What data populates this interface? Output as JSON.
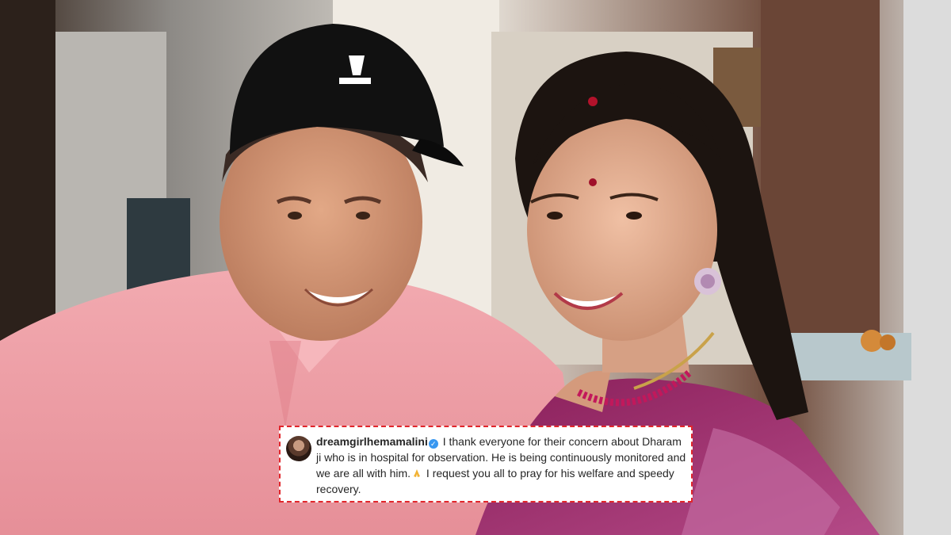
{
  "scene": {
    "description_icon": "photo-of-couple"
  },
  "caption": {
    "username": "dreamgirlhemamalini",
    "text_part1": " I thank everyone for their concern about Dharam ji who is in hospital for observation. He is being continuously monitored and we are all with him.",
    "text_part2": " I request you all to pray for his welfare and speedy recovery.",
    "verified_icon": "verified-badge-icon",
    "emoji_icon": "folded-hands-icon",
    "verified_color": "#3897f0",
    "border_color": "#e1262b"
  }
}
